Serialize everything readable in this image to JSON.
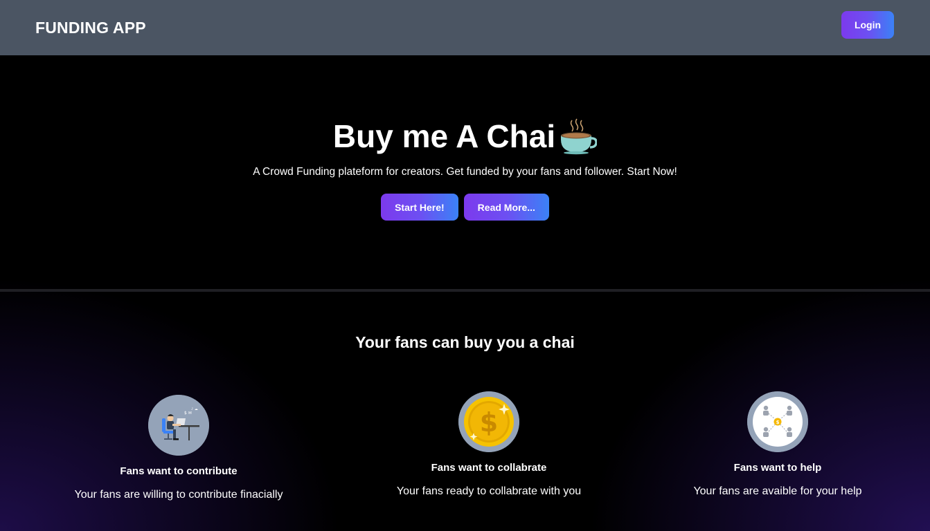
{
  "nav": {
    "brand": "FUNDING APP",
    "login_label": "Login"
  },
  "hero": {
    "title": "Buy me A Chai",
    "title_icon": "chai-cup-icon",
    "subtitle": "A Crowd Funding plateform for creators. Get funded by your fans and follower. Start Now!",
    "start_label": "Start Here!",
    "read_more_label": "Read More..."
  },
  "features": {
    "title": "Your fans can buy you a chai",
    "items": [
      {
        "icon": "person-at-desk-icon",
        "title": "Fans want to contribute",
        "desc": "Your fans are willing to contribute finacially"
      },
      {
        "icon": "gold-coin-dollar-icon",
        "title": "Fans want to collabrate",
        "desc": "Your fans ready to collabrate with you"
      },
      {
        "icon": "people-network-icon",
        "title": "Fans want to help",
        "desc": "Your fans are avaible for your help"
      }
    ]
  },
  "colors": {
    "nav_bg": "#4b5563",
    "accent_start": "#7c3aed",
    "accent_end": "#3b82f6",
    "icon_circle": "#94a3b8"
  }
}
